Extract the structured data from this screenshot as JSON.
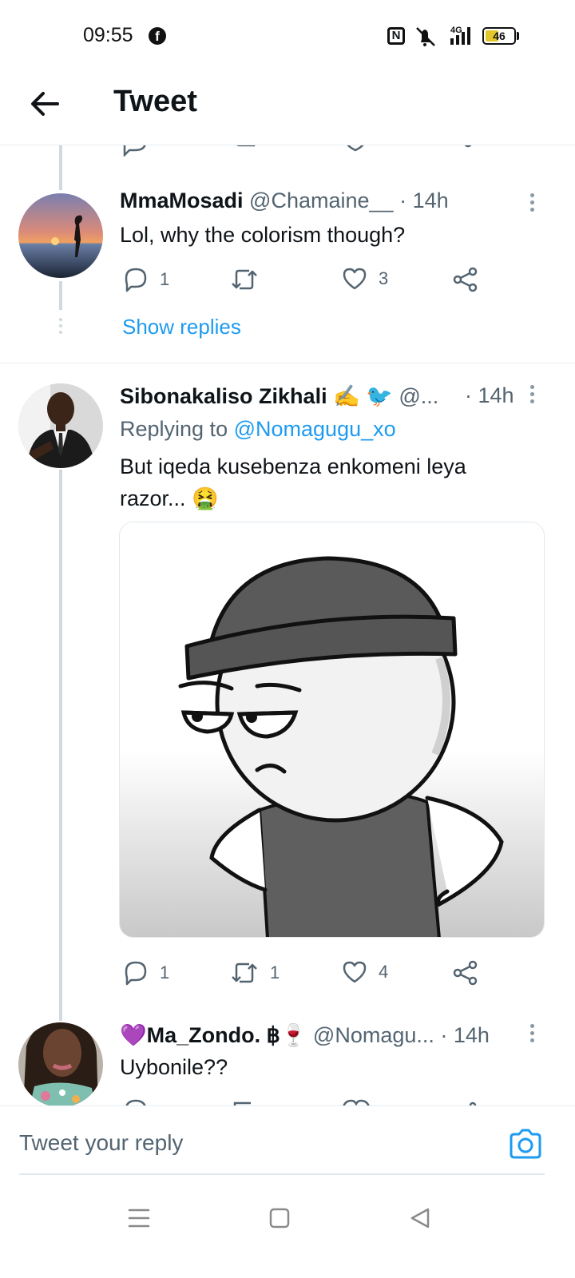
{
  "status_bar": {
    "time": "09:55",
    "network": "4G",
    "battery": "46",
    "battery_level_percent": 46,
    "icons": [
      "facebook-icon",
      "nfc-icon",
      "mute-icon",
      "signal-icon",
      "battery-icon"
    ]
  },
  "header": {
    "title": "Tweet",
    "back_icon": "arrow-left-icon"
  },
  "tweets": [
    {
      "display_name": "MmaMosadi",
      "handle": "@Chamaine__",
      "time": "· 14h",
      "text": "Lol, why the colorism though?",
      "actions": {
        "replies": "1",
        "retweets": "",
        "likes": "3"
      },
      "show_replies": "Show replies"
    },
    {
      "display_name": "Sibonakaliso Zikhali ✍ 🐦",
      "handle": "@...",
      "time": "· 14h",
      "replying_prefix": "Replying to",
      "replying_to": "@Nomagugu_xo",
      "text": "But iqeda kusebenza enkomeni leya razor... 🤮",
      "actions": {
        "replies": "1",
        "retweets": "1",
        "likes": "4"
      }
    },
    {
      "display_name": "💜Ma_Zondo. ฿🍷",
      "handle": "@Nomagu...",
      "time": "· 14h",
      "text": "Uybonile??"
    }
  ],
  "reply_bar": {
    "placeholder": "Tweet your reply",
    "camera_icon": "camera-icon"
  },
  "nav_bar": {
    "icons": [
      "menu-icon",
      "home-square-icon",
      "back-triangle-icon"
    ]
  },
  "colors": {
    "accent": "#1d9bf0",
    "text_primary": "#0f1419",
    "text_secondary": "#536471",
    "thread_line": "#cfd9de"
  }
}
